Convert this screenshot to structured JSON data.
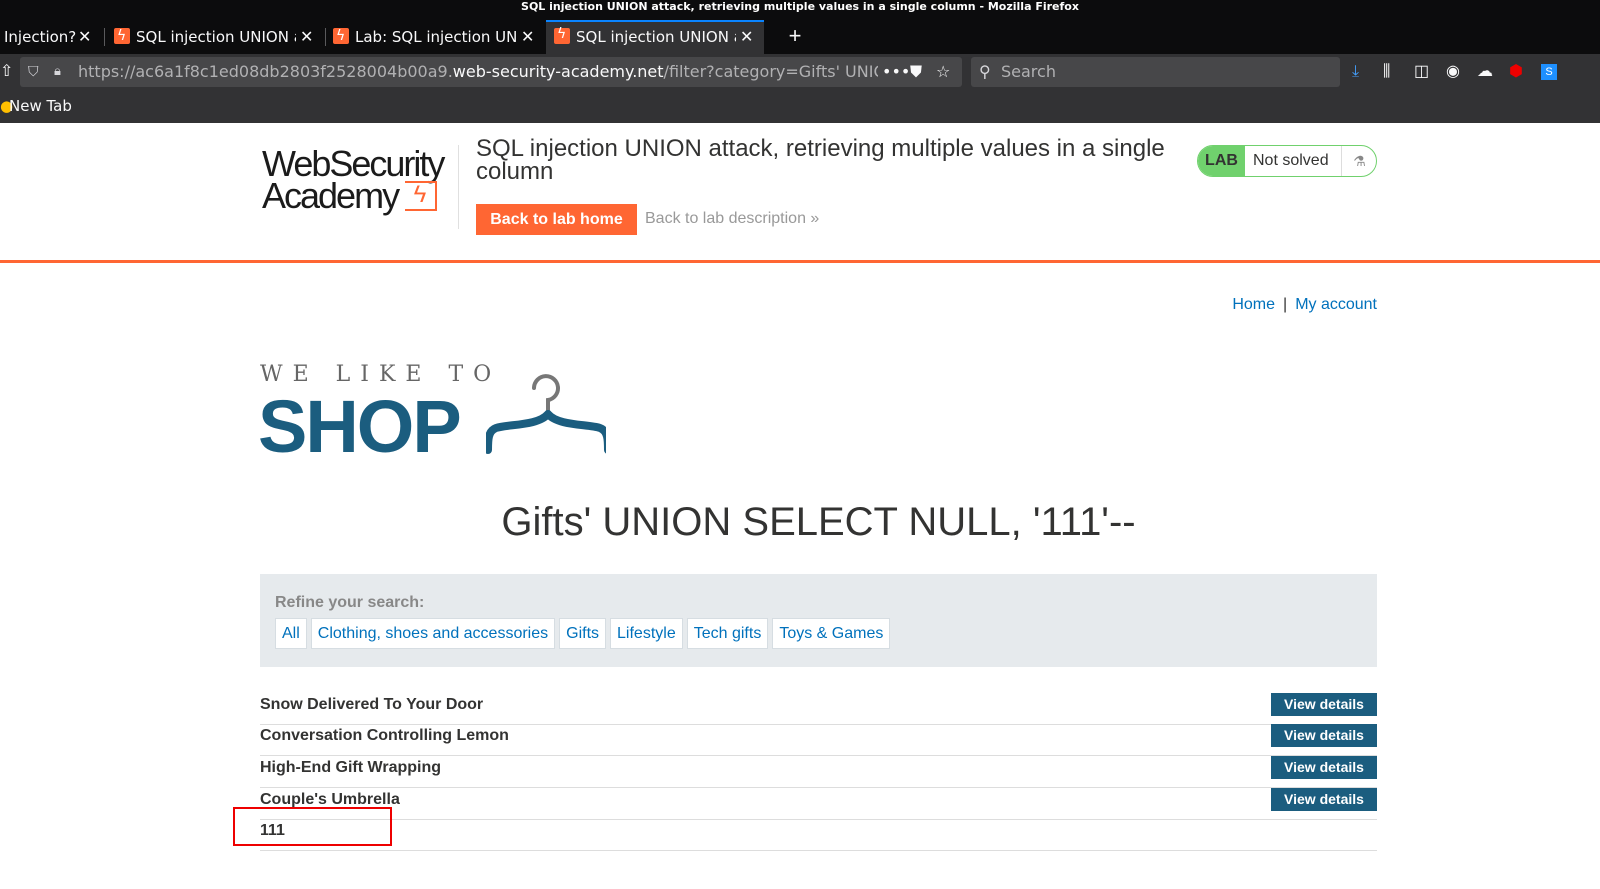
{
  "window": {
    "title": "SQL injection UNION attack, retrieving multiple values in a single column - Mozilla Firefox"
  },
  "tabs": [
    {
      "label": "Injection?",
      "active": false
    },
    {
      "label": "SQL injection UNION a",
      "active": false
    },
    {
      "label": "Lab: SQL injection UNI",
      "active": false
    },
    {
      "label": "SQL injection UNION a",
      "active": true
    }
  ],
  "toolbar": {
    "url_prefix": "https://ac6a1f8c1ed08db2803f2528004b00a9.",
    "url_domain": "web-security-academy.net",
    "url_path": "/filter?category=Gifts' UNION SEL",
    "search_placeholder": "Search",
    "more_glyph": "•••"
  },
  "bookmarks": [
    {
      "label": "New Tab"
    }
  ],
  "lab_header": {
    "logo_line1": "WebSecurity",
    "logo_line2": "Academy",
    "title": "SQL injection UNION attack, retrieving multiple values in a single column",
    "back_home": "Back to lab home",
    "back_description": "Back to lab description",
    "status_badge": "LAB",
    "status_text": "Not solved",
    "colors": {
      "accent": "#ff6633",
      "solved_green": "#70d16d"
    }
  },
  "site_nav": {
    "home": "Home",
    "separator": "|",
    "account": "My account"
  },
  "shop_logo": {
    "tagline": "WE LIKE TO",
    "word": "SHOP",
    "color": "#1b5d7f"
  },
  "search_heading": "Gifts' UNION SELECT NULL, '111'--",
  "filters": {
    "label": "Refine your search:",
    "items": [
      "All",
      "Clothing, shoes and accessories",
      "Gifts",
      "Lifestyle",
      "Tech gifts",
      "Toys & Games"
    ]
  },
  "products": [
    {
      "name": "Snow Delivered To Your Door",
      "action": "View details"
    },
    {
      "name": "Conversation Controlling Lemon",
      "action": "View details"
    },
    {
      "name": "High-End Gift Wrapping",
      "action": "View details"
    },
    {
      "name": "Couple's Umbrella",
      "action": "View details"
    },
    {
      "name": "111",
      "action": ""
    }
  ]
}
